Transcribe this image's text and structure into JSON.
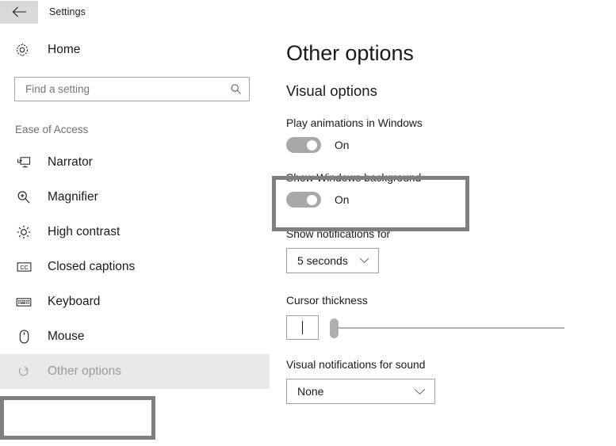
{
  "titlebar": {
    "back_icon": "back-arrow-icon",
    "title": "Settings"
  },
  "sidebar": {
    "home": {
      "icon": "gear-icon",
      "label": "Home"
    },
    "search": {
      "placeholder": "Find a setting",
      "value": "",
      "icon": "search-icon"
    },
    "group_header": "Ease of Access",
    "items": [
      {
        "label": "Narrator",
        "icon": "narrator-monitor-icon",
        "selected": false
      },
      {
        "label": "Magnifier",
        "icon": "magnifier-icon",
        "selected": false
      },
      {
        "label": "High contrast",
        "icon": "high-contrast-sun-icon",
        "selected": false
      },
      {
        "label": "Closed captions",
        "icon": "closed-captions-icon",
        "selected": false
      },
      {
        "label": "Keyboard",
        "icon": "keyboard-icon",
        "selected": false
      },
      {
        "label": "Mouse",
        "icon": "mouse-icon",
        "selected": false
      },
      {
        "label": "Other options",
        "icon": "other-options-icon",
        "selected": true
      }
    ]
  },
  "main": {
    "page_title": "Other options",
    "section_title": "Visual options",
    "play_animations": {
      "label": "Play animations in Windows",
      "state": "On"
    },
    "show_background": {
      "label": "Show Windows background",
      "state": "On"
    },
    "show_notifications": {
      "label": "Show notifications for",
      "value": "5 seconds",
      "chevron": "chevron-down-icon"
    },
    "cursor_thickness": {
      "label": "Cursor thickness",
      "slider_value": 0
    },
    "visual_notifications": {
      "label": "Visual notifications for sound",
      "value": "None",
      "chevron": "chevron-down-icon"
    }
  },
  "annotations": {
    "sidebar_highlight": "Other options",
    "main_highlight": "Show Windows background"
  },
  "colors": {
    "annotation_border": "#7f7f7f",
    "toggle_on": "#a8a8a8",
    "selected_row": "#e9e9e9",
    "back_button_bg": "#d9d9d9"
  }
}
